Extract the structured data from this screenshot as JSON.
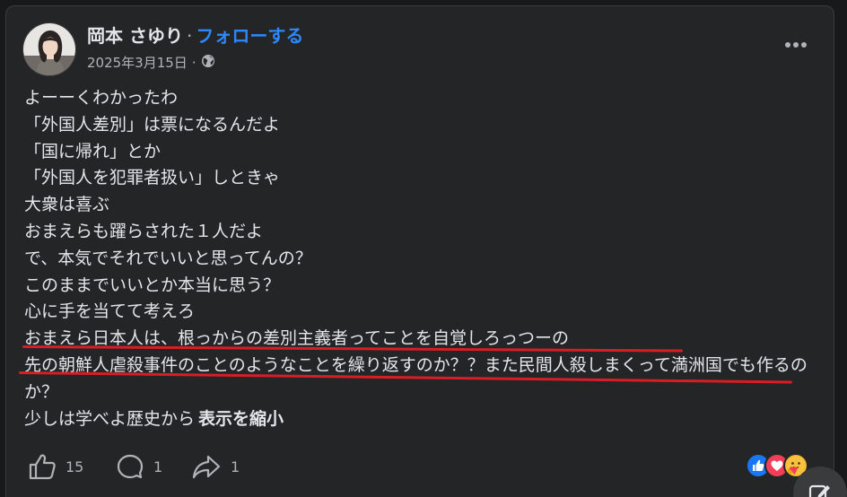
{
  "post": {
    "author": "岡本 さゆり",
    "separator": "·",
    "follow_label": "フォローする",
    "date": "2025年3月15日",
    "meta_dot": "·",
    "privacy_icon": "globe-icon",
    "more_icon": "more-horizontal-icon",
    "lines": [
      "よーーくわかったわ",
      "「外国人差別」は票になるんだよ",
      "「国に帰れ」とか",
      "「外国人を犯罪者扱い」しときゃ",
      "大衆は喜ぶ",
      "おまえらも躍らされた１人だよ",
      "で、本気でそれでいいと思ってんの？",
      "このままでいいとか本当に思う？",
      "心に手を当てて考えろ",
      "おまえら日本人は、根っからの差別主義者ってことを自覚しろっつーの",
      "先の朝鮮人虐殺事件のことのようなことを繰り返すのか？？また民間人殺しまくって満洲国でも作るのか？",
      "少しは学べよ歴史から"
    ],
    "see_less_label": "表示を縮小",
    "underline_color": "#d81e24"
  },
  "actions": {
    "like_count": "15",
    "comment_count": "1",
    "share_count": "1"
  },
  "reactions": [
    "like",
    "love",
    "care"
  ],
  "colors": {
    "background": "#242526",
    "text": "#e4e6eb",
    "secondary": "#b0b3b8",
    "link": "#2d88ff"
  }
}
